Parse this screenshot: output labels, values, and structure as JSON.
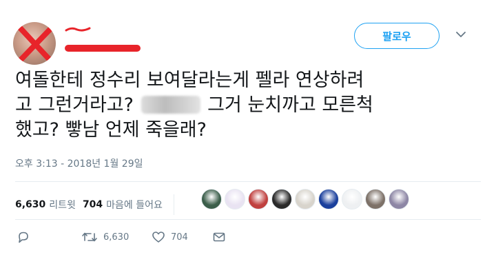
{
  "header": {
    "follow_label": "팔로우"
  },
  "tweet": {
    "line1": "여돌한테 정수리 보여달라는게 펠라 연상하려",
    "line2_a": "고 그런거라고? ",
    "line2_b": " 그거 눈치까고 모른척",
    "line3": "했고? 빻남 언제 죽을래?",
    "timestamp": "오후 3:13 - 2018년 1월 29일"
  },
  "stats": {
    "retweets_count": "6,630",
    "retweets_label": "리트윗",
    "likes_count": "704",
    "likes_label": "마음에 들어요"
  },
  "likers": [
    {
      "color": "#3b5e4a"
    },
    {
      "color": "#e9e3f2"
    },
    {
      "color": "#c0403f"
    },
    {
      "color": "#2a2a2a"
    },
    {
      "color": "#d8d4cc"
    },
    {
      "color": "#1a3f9c"
    },
    {
      "color": "#eef0f2"
    },
    {
      "color": "#7d7168"
    },
    {
      "color": "#8d86a5"
    }
  ],
  "actions": {
    "retweet_count": "6,630",
    "like_count": "704"
  },
  "colors": {
    "accent": "#1da1f2",
    "muted": "#657786",
    "redaction": "#e8242a"
  }
}
